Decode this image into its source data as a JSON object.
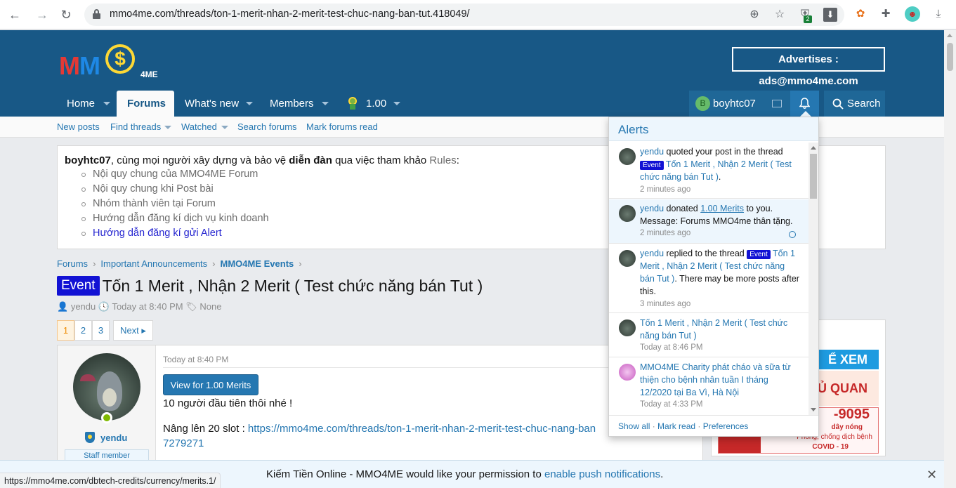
{
  "browser": {
    "url": "mmo4me.com/threads/ton-1-merit-nhan-2-merit-test-chuc-nang-ban-tut.418049/",
    "ext_badge": "2",
    "status_url": "https://mmo4me.com/dbtech-credits/currency/merits.1/"
  },
  "header": {
    "logo_mm": "MM",
    "logo_coin": "$",
    "logo_tag": "4ME",
    "ads": "Advertises : ads@mmo4me.com"
  },
  "nav": {
    "home": "Home",
    "forums": "Forums",
    "whats_new": "What's new",
    "members": "Members",
    "merits": "1.00"
  },
  "account": {
    "avatar_letter": "B",
    "username": "boyhtc07",
    "search": "Search"
  },
  "subnav": {
    "new_posts": "New posts",
    "find_threads": "Find threads",
    "watched": "Watched",
    "search_forums": "Search forums",
    "mark_read": "Mark forums read"
  },
  "notice": {
    "user": "boyhtc07",
    "text1": ", cùng mọi người xây dựng và bảo vệ ",
    "strong": "diễn đàn",
    "text2": " qua việc tham khảo ",
    "rules": "Rules",
    "colon": ":",
    "items": [
      "Nội quy chung của MMO4ME Forum",
      "Nội quy chung khi Post bài",
      "Nhóm thành viên tại Forum",
      "Hướng dẫn đăng kí dịch vụ kinh doanh",
      "Hướng dẫn đăng kí gửi Alert"
    ]
  },
  "breadcrumb": [
    "Forums",
    "Important Announcements",
    "MMO4ME Events"
  ],
  "thread": {
    "prefix": "Event",
    "title": "Tốn 1 Merit , Nhận 2 Merit ( Test chức năng bán Tut )",
    "author": "yendu",
    "date": "Today at 8:40 PM",
    "tags": "None"
  },
  "pagination": {
    "pages": [
      "1",
      "2",
      "3"
    ],
    "next": "Next ▸"
  },
  "post": {
    "username": "yendu",
    "user_title": "Staff member",
    "time": "Today at 8:40 PM",
    "merit_button": "View for 1.00 Merits",
    "line1": "10 người đầu tiên thôi nhé !",
    "line2_prefix": "Nâng lên 20 slot : ",
    "line2_link": "https://mmo4me.com/threads/ton-1-merit-nhan-2-merit-test-chuc-nang-ban",
    "line3": "7279271"
  },
  "ad": {
    "line1": "Ể XEM",
    "line2": "HỦ QUAN",
    "phone": "-9095",
    "sub1": "dây nóng",
    "sub2": "Phòng, chống dịch bệnh",
    "sub3": "COVID - 19"
  },
  "alerts": {
    "title": "Alerts",
    "items": [
      {
        "user": "yendu",
        "action": " quoted your post in the thread ",
        "prefix": "Event",
        "thread": " Tốn 1 Merit , Nhận 2 Merit ( Test chức năng bán Tut )",
        "end": ".",
        "time": "2 minutes ago"
      },
      {
        "user": "yendu",
        "action": " donated ",
        "amount": "1.00 Merits",
        "to": " to you.",
        "message": "Message: Forums MMO4me thân tặng.",
        "time": "2 minutes ago"
      },
      {
        "user": "yendu",
        "action": " replied to the thread ",
        "prefix": "Event",
        "thread": " Tốn 1 Merit , Nhận 2 Merit ( Test chức năng bán Tut )",
        "tail": ". There may be more posts after this.",
        "time": "3 minutes ago"
      },
      {
        "thread": "Tốn 1 Merit , Nhận 2 Merit ( Test chức năng bán Tut )",
        "time": "Today at 8:46 PM"
      },
      {
        "thread": "MMO4ME Charity phát cháo và sữa từ thiện cho bệnh nhân tuần I tháng 12/2020 tại Ba Vì, Hà Nội",
        "time": "Today at 4:33 PM"
      }
    ],
    "footer": {
      "show_all": "Show all",
      "mark_read": "Mark read",
      "preferences": "Preferences",
      "sep": " · "
    }
  },
  "push": {
    "text": "Kiếm Tiền Online - MMO4ME would like your permission to ",
    "link": "enable push notifications",
    "end": ".",
    "close": "✕"
  }
}
